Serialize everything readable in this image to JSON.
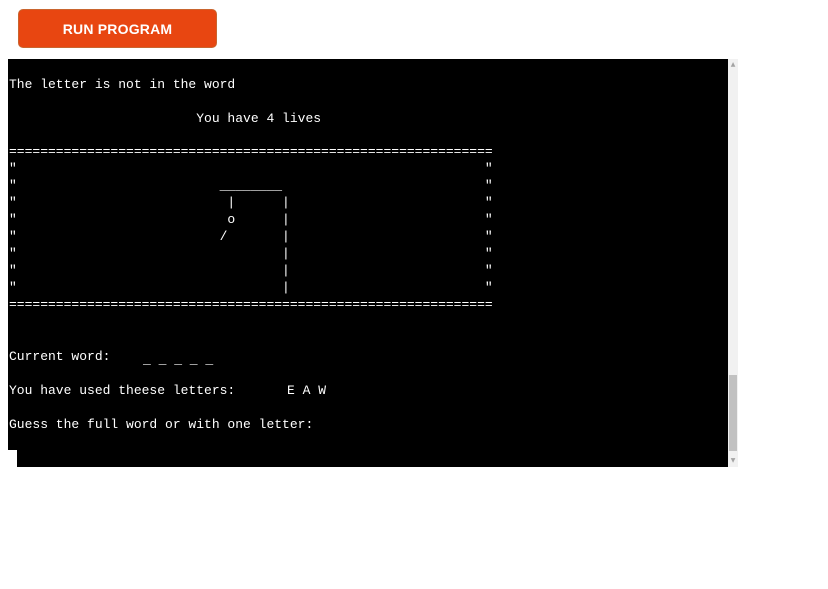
{
  "toolbar": {
    "run_label": "RUN PROGRAM",
    "accent_color": "#e84611"
  },
  "terminal": {
    "background_color": "#000000",
    "text_color": "#ffffff",
    "message": "The letter is not in the word",
    "lives": "                        You have 4 lives",
    "border_top": "==============================================================",
    "gallows_1": "\"                                                            \"",
    "gallows_2": "\"                          ________                          \"",
    "gallows_3": "\"                           |      |                         \"",
    "gallows_4": "\"                           o      |                         \"",
    "gallows_5": "\"                          /       |                         \"",
    "gallows_6": "\"                                  |                         \"",
    "gallows_7": "\"                                  |                         \"",
    "gallows_8": "\"                                  |                         \"",
    "border_bottom": "==============================================================",
    "current_word_label": "Current word:",
    "current_word_value": "_ _ _ _ _",
    "used_letters_label": "You have used theese letters:",
    "used_letters_value": "E A W",
    "prompt": "Guess the full word or with one letter:"
  },
  "scrollbar": {
    "up_arrow_icon": "triangle-up",
    "down_arrow_icon": "triangle-down"
  }
}
